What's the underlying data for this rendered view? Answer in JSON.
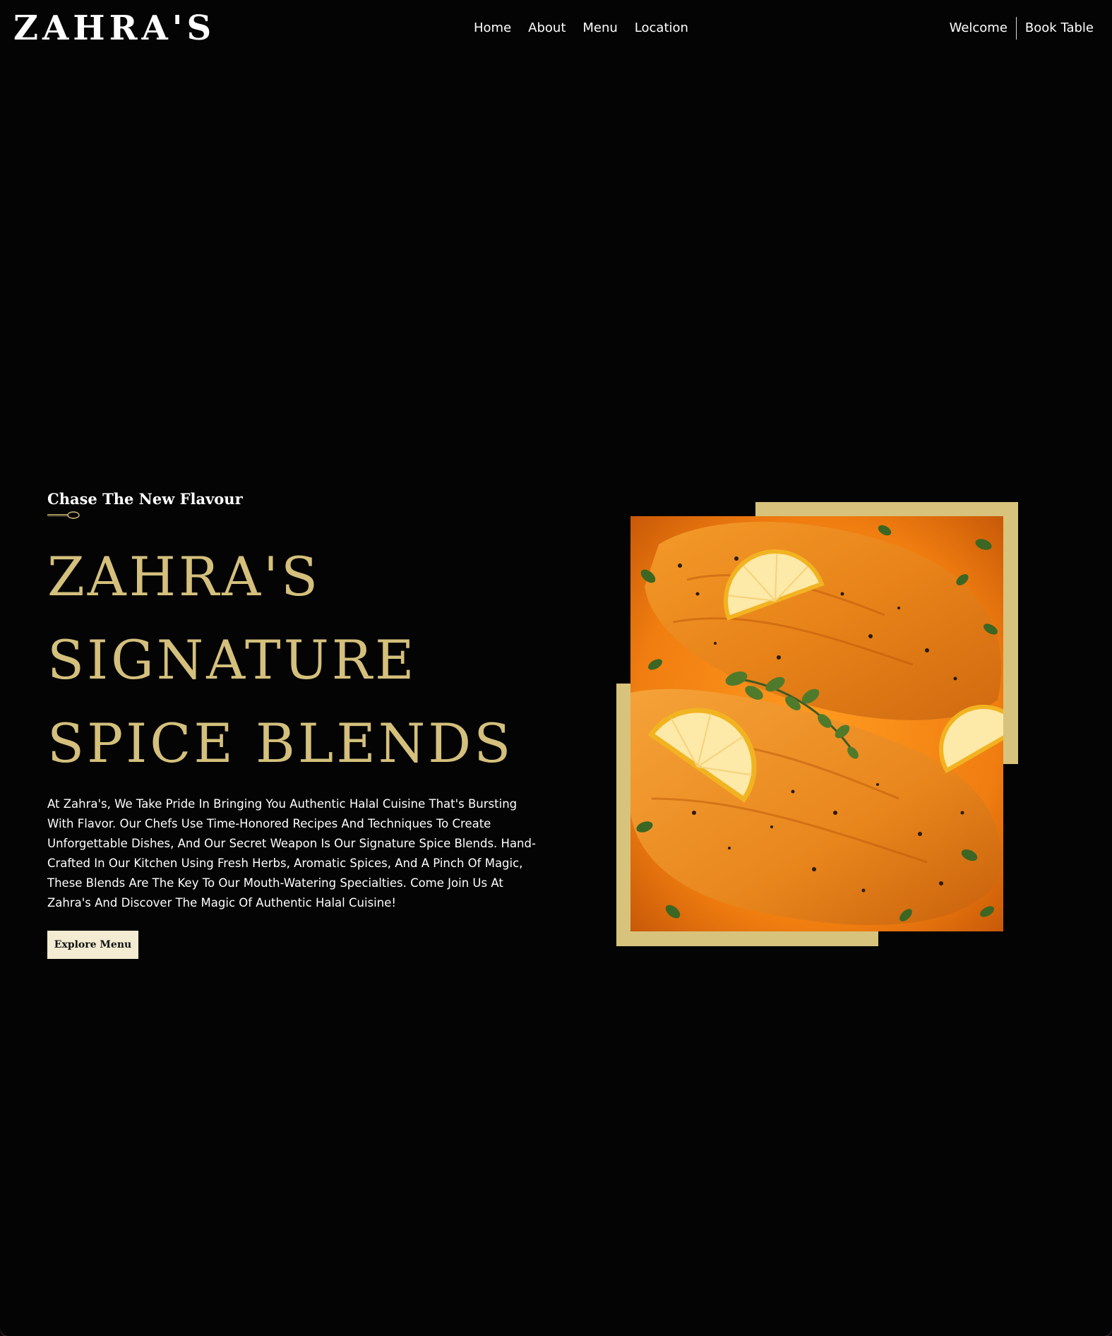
{
  "header": {
    "logo": "ZAHRA'S",
    "nav": [
      "Home",
      "About",
      "Menu",
      "Location"
    ],
    "welcome_label": "Welcome",
    "book_table_label": "Book Table"
  },
  "hero": {
    "eyebrow": "Chase The New Flavour",
    "title_lines": [
      "ZAHRA'S",
      "SIGNATURE",
      "SPICE BLENDS"
    ],
    "description": "At Zahra's, We Take Pride In Bringing You Authentic Halal Cuisine That's Bursting With Flavor. Our Chefs Use Time-Honored Recipes And Techniques To Create Unforgettable Dishes, And Our Secret Weapon Is Our Signature Spice Blends. Hand-Crafted In Our Kitchen Using Fresh Herbs, Aromatic Spices, And A Pinch Of Magic, These Blends Are The Key To Our Mouth-Watering Specialties. Come Join Us At Zahra's And Discover The Magic Of Authentic Halal Cuisine!",
    "cta_label": "Explore Menu"
  },
  "colors": {
    "background": "#040404",
    "gold": "#d4c07c",
    "frame_gold": "#d7c37c",
    "cta_background": "#f3ecd2"
  },
  "icons": {
    "spoon": "spoon-divider-icon"
  }
}
